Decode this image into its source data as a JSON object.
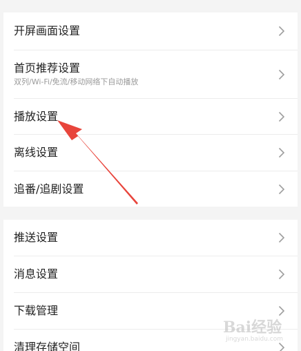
{
  "settings_group_1": {
    "items": [
      {
        "label": "开屏画面设置"
      },
      {
        "label": "首页推荐设置",
        "sublabel": "双列/Wi-Fi/免流/移动网络下自动播放"
      },
      {
        "label": "播放设置"
      },
      {
        "label": "离线设置"
      },
      {
        "label": "追番/追剧设置"
      }
    ]
  },
  "settings_group_2": {
    "items": [
      {
        "label": "推送设置"
      },
      {
        "label": "消息设置"
      },
      {
        "label": "下载管理"
      },
      {
        "label": "清理存储空间"
      }
    ]
  },
  "annotation": {
    "arrow_color": "#e8453c"
  },
  "watermark": {
    "main": "Bai经验",
    "sub": "jingyan.baidu.com"
  },
  "colors": {
    "background": "#f4f4f4",
    "card": "#ffffff",
    "text": "#222222",
    "subtext": "#9a9a9a",
    "chevron": "#9e9e9e",
    "divider": "#ececec"
  }
}
